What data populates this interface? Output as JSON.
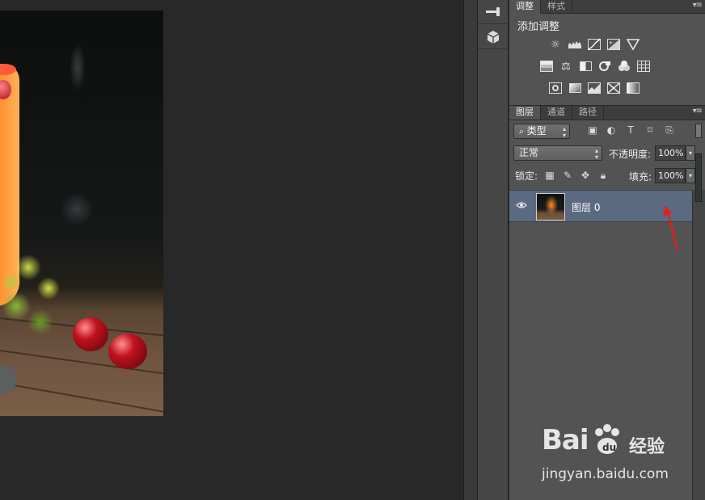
{
  "adjustments_panel": {
    "tabs": [
      {
        "label": "调整"
      },
      {
        "label": "样式"
      }
    ],
    "title": "添加调整",
    "menu_icon": "panel-menu-icon",
    "row1": [
      "brightness-contrast-icon",
      "levels-icon",
      "curves-icon",
      "exposure-icon",
      "vibrance-icon"
    ],
    "row2": [
      "hue-saturation-icon",
      "color-balance-icon",
      "black-white-icon",
      "photo-filter-icon",
      "channel-mixer-icon",
      "color-lookup-icon"
    ],
    "row3": [
      "invert-icon",
      "posterize-icon",
      "threshold-icon",
      "selective-color-icon",
      "gradient-map-icon"
    ]
  },
  "layers_panel": {
    "tabs": [
      {
        "label": "图层"
      },
      {
        "label": "通道"
      },
      {
        "label": "路径"
      }
    ],
    "filter_kind": "类型",
    "filter_icons": [
      "pixel-filter-icon",
      "adjustment-filter-icon",
      "type-filter-icon",
      "shape-filter-icon",
      "smart-object-filter-icon"
    ],
    "blend_mode": "正常",
    "opacity_label": "不透明度:",
    "opacity_value": "100%",
    "lock_label": "锁定:",
    "lock_icons": [
      "lock-transparent-icon",
      "lock-image-icon",
      "lock-position-icon",
      "lock-all-icon"
    ],
    "fill_label": "填充:",
    "fill_value": "100%",
    "layers": [
      {
        "name": "图层 0",
        "visible": true,
        "selected": true
      }
    ]
  },
  "dock": {
    "icons": [
      "tool-preset-icon",
      "3d-cube-icon"
    ]
  },
  "watermark": {
    "logo": "Bai",
    "logo_suffix": "经验",
    "url": "jingyan.baidu.com"
  },
  "colors": {
    "selected_layer": "#5b6a80",
    "panel": "#535353",
    "annotation_arrow": "#e02020"
  }
}
